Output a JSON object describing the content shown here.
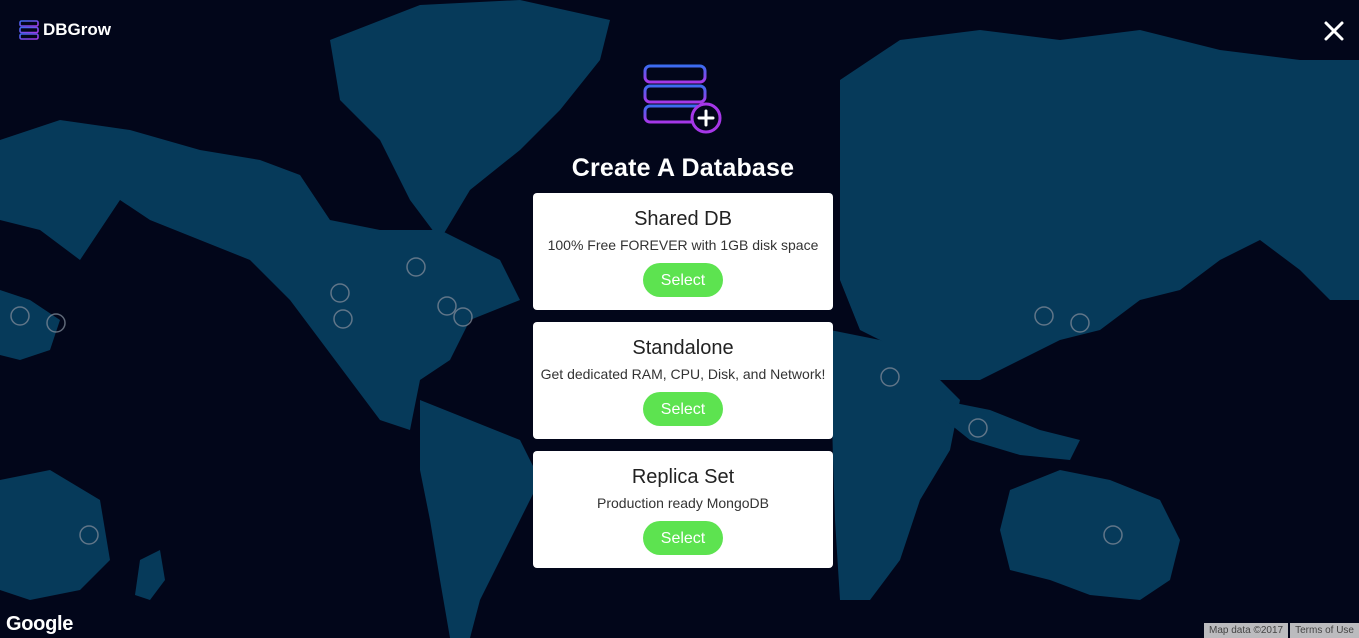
{
  "app": {
    "name": "DBGrow"
  },
  "header": {
    "close_icon": "close-icon"
  },
  "hero": {
    "title": "Create A Database",
    "icon": "database-add-icon"
  },
  "plans": [
    {
      "title": "Shared DB",
      "description": "100% Free FOREVER with 1GB disk space",
      "button": "Select"
    },
    {
      "title": "Standalone",
      "description": "Get dedicated RAM, CPU, Disk, and Network!",
      "button": "Select"
    },
    {
      "title": "Replica Set",
      "description": "Production ready MongoDB",
      "button": "Select"
    }
  ],
  "map": {
    "provider_logo": "Google",
    "attribution": "Map data ©2017",
    "terms": "Terms of Use"
  },
  "colors": {
    "background": "#02061a",
    "land": "#063a5a",
    "accent_green": "#5de350",
    "icon_gradient_start": "#3b6cf0",
    "icon_gradient_end": "#a637e8"
  }
}
